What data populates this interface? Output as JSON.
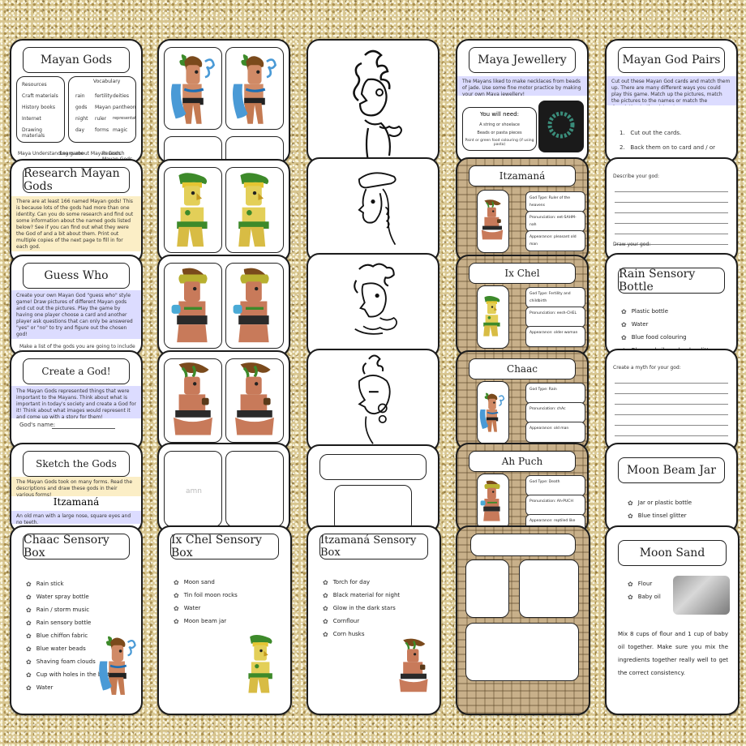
{
  "col1": {
    "mayan_gods": {
      "title": "Mayan Gods",
      "resources": [
        "Resources",
        "Craft materials",
        "History books",
        "Internet",
        "Drawing materials"
      ],
      "vocab_heading": "Vocabulary",
      "vocab_left": [
        "rain",
        "gods",
        "night",
        "day"
      ],
      "vocab_right": [
        "deities",
        "pantheon",
        "representations",
        "magic"
      ],
      "vocab_mid": [
        "fertility",
        "Mayan",
        "ruler",
        "forms"
      ],
      "tags": [
        "Maya Understanding game",
        "Learn about Mayan Gods",
        "Research Mayan Gods"
      ]
    },
    "research": {
      "title": "Research Mayan Gods",
      "text": "There are at least 166 named Mayan gods! This is because lots of the gods had more than one identity. Can you do some research and find out some information about the named gods listed below? See if you can find out what they were the God of and a bit about them. Print out multiple copies of the next page to fill in for each god."
    },
    "guess_who": {
      "title": "Guess Who",
      "text": "Create your own Mayan God \"guess who\" style game! Draw pictures of different Mayan gods and cut out the pictures. Play the game by having one player choose a card and another player ask questions that can only be answered \"yes\" or \"no\" to try and figure out the chosen god!",
      "footer": "Make a list of the gods you are going to include in your"
    },
    "create": {
      "title": "Create a God!",
      "text": "The Mayan Gods represented things that were important to the Mayans. Think about what is important in today's society and create a God for it! Think about what images would represent it and come up with a story for them!",
      "field": "God's name:"
    },
    "sketch": {
      "title": "Sketch the Gods",
      "text": "The Mayan Gods took on many forms. Read the descriptions and draw these gods in their various forms!",
      "god": "Itzamaná",
      "desc": "An old man with a large nose, square eyes and no teeth."
    },
    "chaac_box": {
      "title": "Chaac Sensory Box",
      "items": [
        "Rain stick",
        "Water spray bottle",
        "Rain / storm music",
        "Rain sensory bottle",
        "Blue chiffon fabric",
        "Blue water beads",
        "Shaving foam clouds",
        "Cup with holes in the bottom",
        "Water"
      ]
    }
  },
  "col2": {
    "faint_word": "amn",
    "ixchel_box": {
      "title": "Ix Chel Sensory Box",
      "items": [
        "Moon sand",
        "Tin foil moon rocks",
        "Water",
        "Moon beam jar"
      ]
    }
  },
  "col3": {
    "itzamana_box": {
      "title": "Itzamaná Sensory Box",
      "items": [
        "Torch for day",
        "Black material for night",
        "Glow in the dark stars",
        "Cornflour",
        "Corn husks"
      ]
    }
  },
  "col4": {
    "jewellery": {
      "title": "Maya Jewellery",
      "text": "The Mayans liked to make necklaces from beads of jade. Use some fine motor practice by making your own Maya jewellery!",
      "need_title": "You will need:",
      "need": [
        "A string or shoelace",
        "Beads or pasta pieces",
        "Paint or green food colouring (if using pasta)"
      ]
    },
    "gods": [
      {
        "name": "Itzamaná",
        "type": "God Type: Ruler of the heavens",
        "pron": "Pronunciation: eet-SAHM-nah",
        "appear": "Appearance: pleasant old man"
      },
      {
        "name": "Ix Chel",
        "type": "God Type: Fertility and childbirth",
        "pron": "Pronunciation: eesh-CHEL",
        "appear": "Appearance: older woman"
      },
      {
        "name": "Chaac",
        "type": "God Type: Rain",
        "pron": "Pronunciation: chAc",
        "appear": "Appearance: old man"
      },
      {
        "name": "Ah Puch",
        "type": "God Type: Death",
        "pron": "Pronunciation: Ah-PUCH",
        "appear": "Appearance: reptiled like"
      }
    ]
  },
  "col5": {
    "pairs": {
      "title": "Mayan God Pairs",
      "text": "Cut out these Mayan God cards and match them up. There are many different ways you could play this game. Match up the pictures, match the pictures to the names or match the description to the picture!",
      "steps": [
        "1.   Cut out the cards.",
        "2.   Back them on to card and / or"
      ]
    },
    "describe": {
      "label": "Describe your god:",
      "draw": "Draw your god:"
    },
    "rain_bottle": {
      "title": "Rain Sensory Bottle",
      "items": [
        "Plastic bottle",
        "Water",
        "Blue food colouring",
        "Blue and silver chunky glitter"
      ]
    },
    "myth": {
      "label": "Create a myth for your god:"
    },
    "moon_jar": {
      "title": "Moon Beam Jar",
      "items": [
        "Jar or plastic bottle",
        "Blue tinsel glitter"
      ]
    },
    "moon_sand": {
      "title": "Moon Sand",
      "items": [
        "Flour",
        "Baby oil"
      ],
      "text": "Mix 8 cups of flour and 1 cup of baby oil together. Make sure you mix the ingredients together really well to get the correct consistency."
    }
  },
  "colors": {
    "yellow_band": "#fbeec6",
    "blue_band": "#dcdcff",
    "glitter": "#d8c690",
    "jade": "#3a8c7a"
  }
}
